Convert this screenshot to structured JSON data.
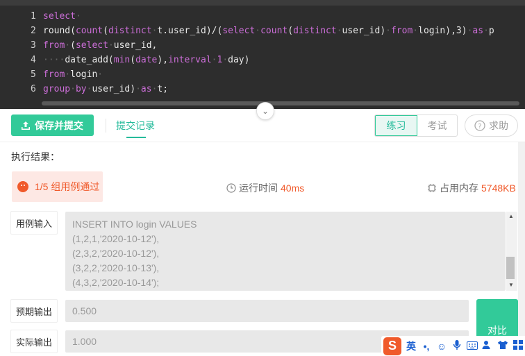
{
  "editor": {
    "line_numbers": [
      "1",
      "2",
      "3",
      "4",
      "5",
      "6"
    ]
  },
  "toolbar": {
    "submit_label": "保存并提交",
    "history_label": "提交记录",
    "mode_practice": "练习",
    "mode_exam": "考试",
    "help_label": "求助"
  },
  "results": {
    "title": "执行结果：",
    "status": "1/5 组用例通过",
    "runtime_label": "运行时间",
    "runtime_value": "40ms",
    "memory_label": "占用内存",
    "memory_value": "5748KB",
    "input_label": "用例输入",
    "input_lines": [
      "INSERT INTO login VALUES",
      "(1,2,1,'2020-10-12'),",
      "(2,3,2,'2020-10-12'),",
      "(3,2,2,'2020-10-13'),",
      "(4,3,2,'2020-10-14');"
    ],
    "expected_label": "预期输出",
    "expected_value": "0.500",
    "actual_label": "实际输出",
    "actual_value": "1.000",
    "compare_label": "对比"
  },
  "ime": {
    "logo": "S",
    "lang": "英"
  },
  "colors": {
    "accent": "#32ca99",
    "error": "#f05a2b",
    "editor_bg": "#2d2d2d",
    "keyword": "#cc6ed8"
  }
}
